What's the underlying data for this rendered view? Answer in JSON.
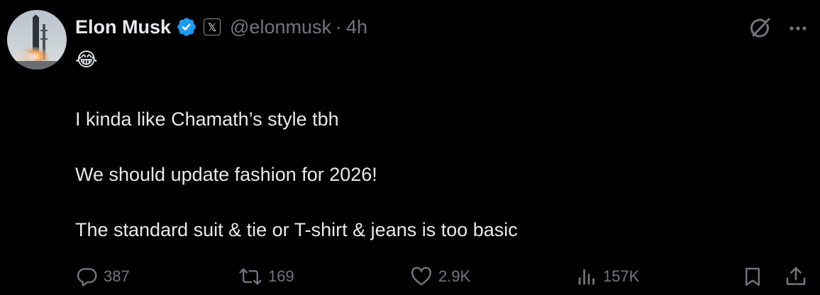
{
  "tweet": {
    "author": {
      "name": "Elon Musk",
      "handle": "@elonmusk",
      "affiliation_badge": "𝕏"
    },
    "separator": "·",
    "time": "4h",
    "emoji": "😂",
    "lines": [
      "I kinda like Chamath’s style tbh",
      "We should update fashion for 2026!",
      "The standard suit & tie or T-shirt & jeans is too basic"
    ],
    "stats": {
      "replies": "387",
      "reposts": "169",
      "likes": "2.9K",
      "views": "157K"
    }
  },
  "icons": {
    "verified": "verified-badge-icon",
    "grok": "grok-icon",
    "more": "more-icon",
    "reply": "reply-icon",
    "repost": "repost-icon",
    "like": "heart-icon",
    "views": "analytics-icon",
    "bookmark": "bookmark-icon",
    "share": "share-icon"
  },
  "colors": {
    "background": "#000000",
    "text": "#e7e9ea",
    "muted": "#71767b",
    "verified": "#1d9bf0"
  }
}
